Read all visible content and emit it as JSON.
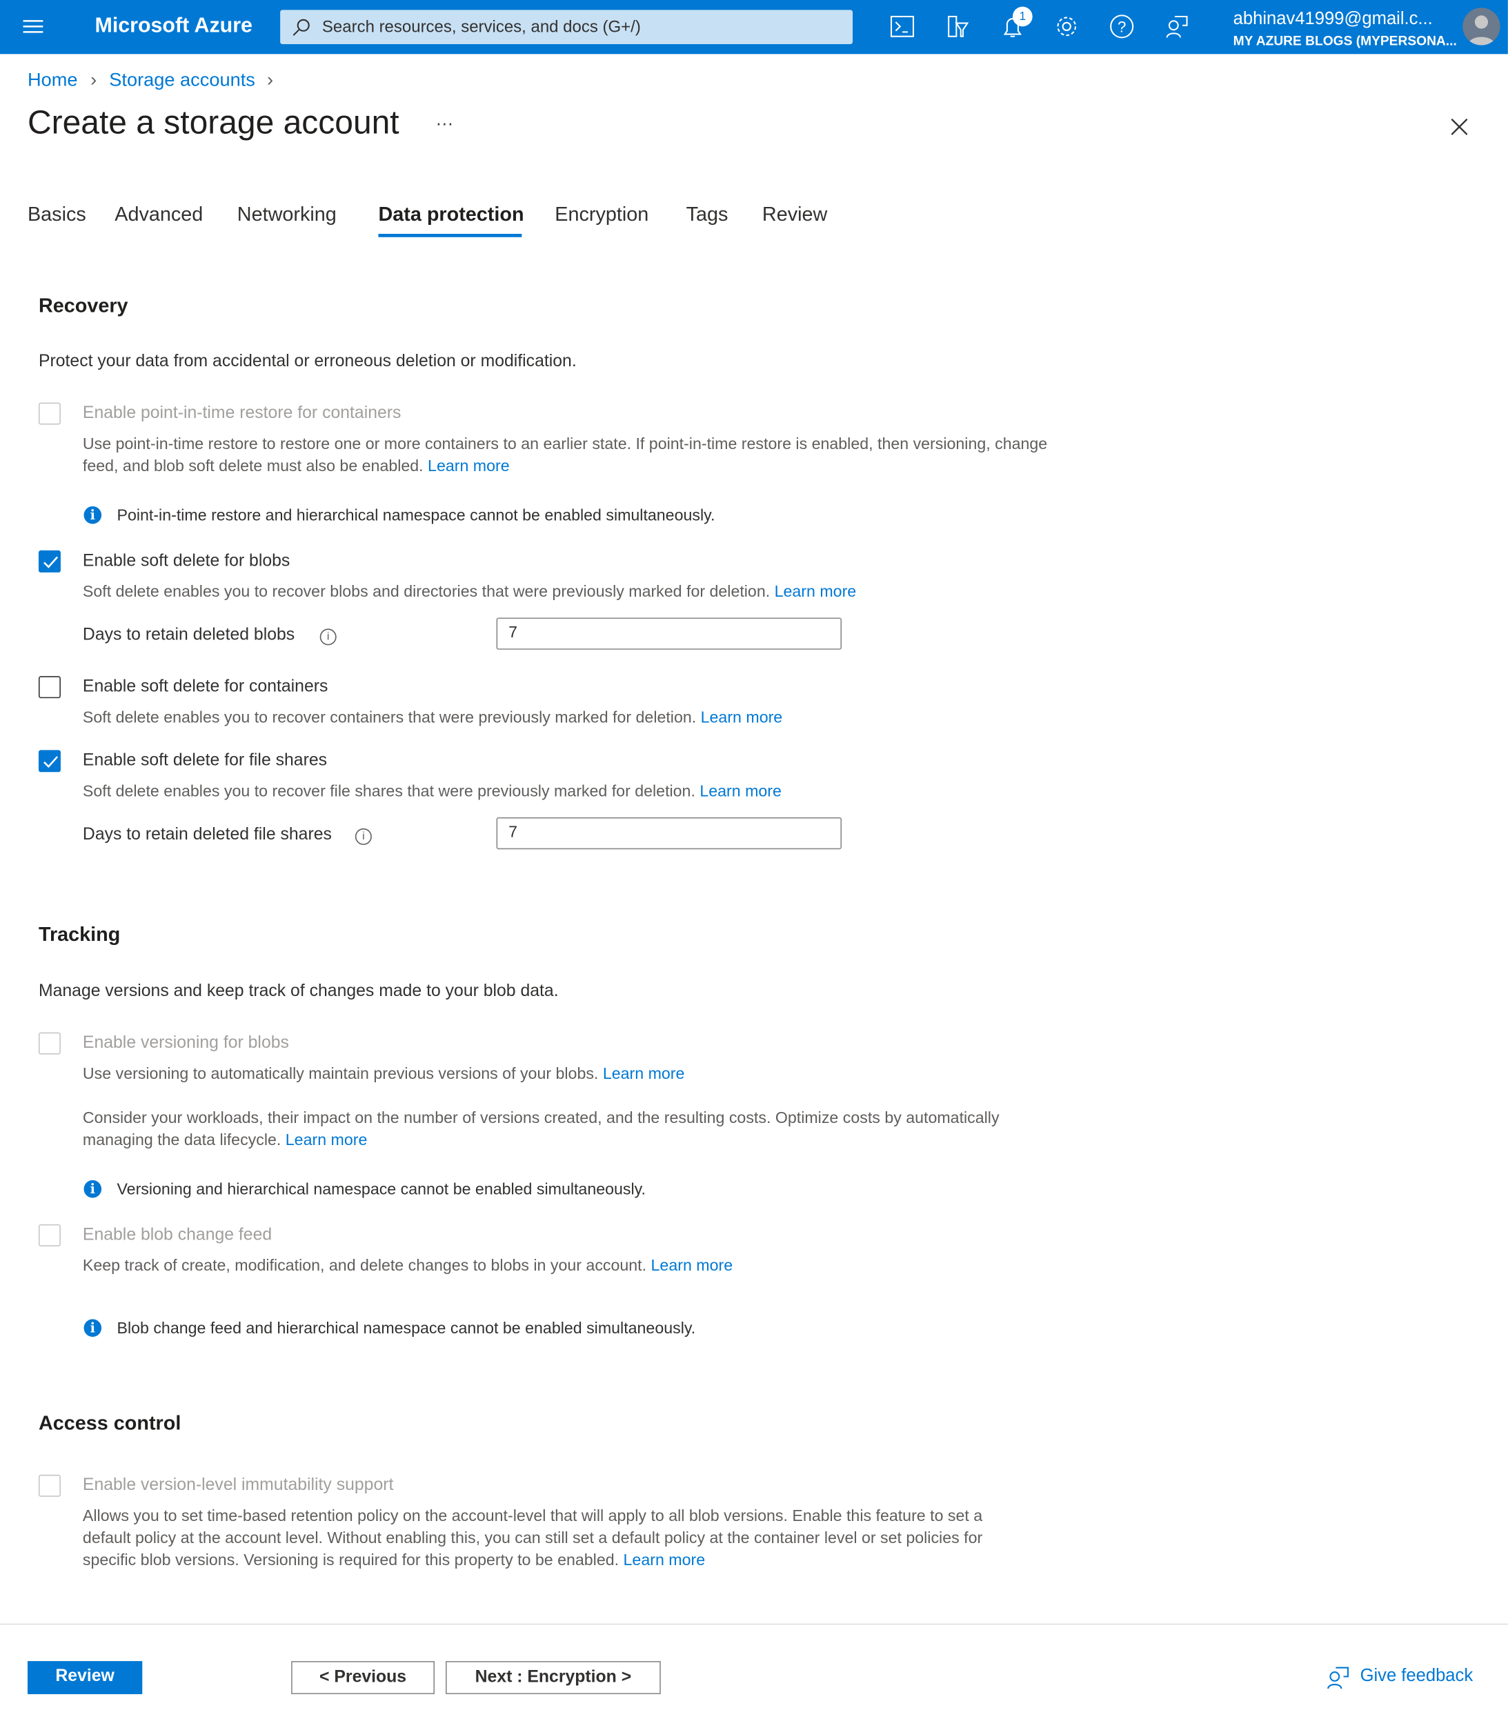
{
  "header": {
    "brand": "Microsoft Azure",
    "search_placeholder": "Search resources, services, and docs (G+/)",
    "notification_count": "1",
    "user_email": "abhinav41999@gmail.c...",
    "user_directory": "MY AZURE BLOGS (MYPERSONA..."
  },
  "breadcrumb": [
    "Home",
    "Storage accounts"
  ],
  "page": {
    "title": "Create a storage account",
    "more": "···"
  },
  "tabs": [
    "Basics",
    "Advanced",
    "Networking",
    "Data protection",
    "Encryption",
    "Tags",
    "Review"
  ],
  "recovery": {
    "heading": "Recovery",
    "description": "Protect your data from accidental or erroneous deletion or modification.",
    "pitr": {
      "label": "Enable point-in-time restore for containers",
      "checked": false,
      "disabled": true,
      "desc": "Use point-in-time restore to restore one or more containers to an earlier state. If point-in-time restore is enabled, then versioning, change feed, and blob soft delete must also be enabled.",
      "link": "Learn more",
      "info": "Point-in-time restore and hierarchical namespace cannot be enabled simultaneously."
    },
    "blobs": {
      "label": "Enable soft delete for blobs",
      "checked": true,
      "desc": "Soft delete enables you to recover blobs and directories that were previously marked for deletion.",
      "link": "Learn more",
      "days_label": "Days to retain deleted blobs",
      "days_value": "7"
    },
    "containers": {
      "label": "Enable soft delete for containers",
      "checked": false,
      "desc": "Soft delete enables you to recover containers that were previously marked for deletion.",
      "link": "Learn more"
    },
    "shares": {
      "label": "Enable soft delete for file shares",
      "checked": true,
      "desc": "Soft delete enables you to recover file shares that were previously marked for deletion.",
      "link": "Learn more",
      "days_label": "Days to retain deleted file shares",
      "days_value": "7"
    }
  },
  "tracking": {
    "heading": "Tracking",
    "description": "Manage versions and keep track of changes made to your blob data.",
    "versioning": {
      "label": "Enable versioning for blobs",
      "checked": false,
      "disabled": true,
      "desc": "Use versioning to automatically maintain previous versions of your blobs.",
      "link": "Learn more",
      "desc2": "Consider your workloads, their impact on the number of versions created, and the resulting costs. Optimize costs by automatically managing the data lifecycle.",
      "link2": "Learn more",
      "info": "Versioning and hierarchical namespace cannot be enabled simultaneously."
    },
    "changefeed": {
      "label": "Enable blob change feed",
      "checked": false,
      "disabled": true,
      "desc": "Keep track of create, modification, and delete changes to blobs in your account.",
      "link": "Learn more",
      "info": "Blob change feed and hierarchical namespace cannot be enabled simultaneously."
    }
  },
  "access": {
    "heading": "Access control",
    "immutability": {
      "label": "Enable version-level immutability support",
      "checked": false,
      "disabled": true,
      "desc": "Allows you to set time-based retention policy on the account-level that will apply to all blob versions. Enable this feature to set a default policy at the account level. Without enabling this, you can still set a default policy at the container level or set policies for specific blob versions. Versioning is required for this property to be enabled.",
      "link": "Learn more"
    }
  },
  "footer": {
    "review": "Review",
    "previous": "< Previous",
    "next": "Next : Encryption >",
    "feedback": "Give feedback"
  }
}
